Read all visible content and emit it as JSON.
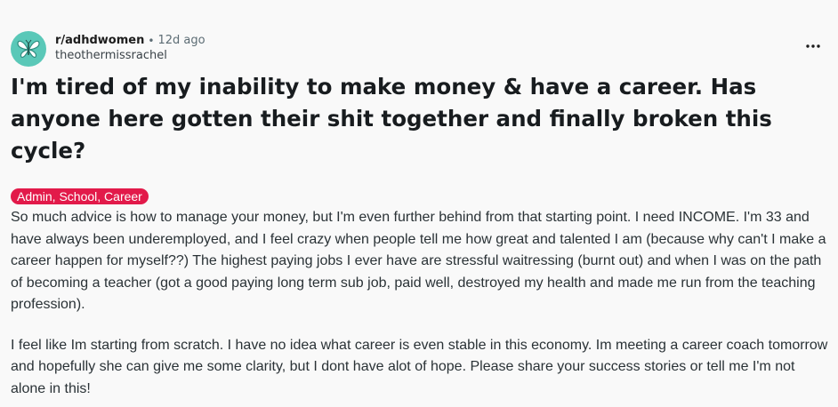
{
  "post": {
    "subreddit": "r/adhdwomen",
    "separator": "•",
    "time_ago": "12d ago",
    "author": "theothermissrachel",
    "title": "I'm tired of my inability to make money & have a career. Has anyone here gotten their shit together and finally broken this cycle?",
    "flair": "Admin, School, Career",
    "body_paragraphs": [
      "So much advice is how to manage your money, but I'm even further behind from that starting point. I need INCOME. I'm 33 and have always been underemployed, and I feel crazy when people tell me how great and talented I am (because why can't I make a career happen for myself??) The highest paying jobs I ever have are stressful waitressing (burnt out) and when I was on the path of becoming a teacher (got a good paying long term sub job, paid well, destroyed my health and made me run from the teaching profession).",
      "I feel like Im starting from scratch. I have no idea what career is even stable in this economy. Im meeting a career coach tomorrow and hopefully she can give me some clarity, but I dont have alot of hope. Please share your success stories or tell me I'm not alone in this!"
    ]
  },
  "icons": {
    "avatar": "butterfly-icon",
    "menu": "more-options-icon"
  },
  "colors": {
    "avatar_bg": "#5ac8b8",
    "flair_bg": "#e21a4a",
    "flair_text": "#ffffff",
    "page_bg": "#f9f9f9"
  }
}
